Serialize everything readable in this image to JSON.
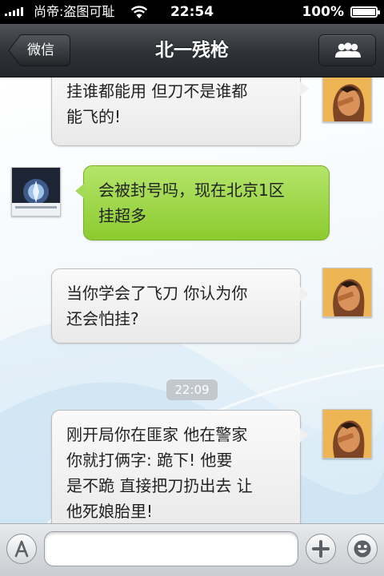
{
  "status_bar": {
    "carrier": "尚帝:盗图可耻",
    "time": "22:54",
    "battery_percent": "100%",
    "battery_level": 1.0,
    "signal_bars": 5,
    "wifi_icon": "wifi-icon"
  },
  "nav": {
    "back_label": "微信",
    "title": "北一残枪",
    "contacts_icon": "contacts-icon"
  },
  "messages": [
    {
      "side": "right",
      "text": "挂谁都能用 但刀不是谁都\n能飞的!"
    },
    {
      "side": "left",
      "text": "会被封号吗，现在北京1区\n挂超多"
    },
    {
      "side": "right",
      "text": "当你学会了飞刀 你认为你\n还会怕挂?"
    },
    {
      "side": "right",
      "text": "刚开局你在匪家 他在警家\n你就打俩字: 跪下! 他要\n是不跪 直接把刀扔出去 让\n他死娘胎里!"
    }
  ],
  "timestamp": "22:09",
  "input_bar": {
    "text_value": "",
    "left_icon": "keyboard-a-icon",
    "plus_icon": "plus-icon",
    "emoji_icon": "smiley-icon"
  },
  "colors": {
    "green_bubble": "#a4db56",
    "gray_bubble": "#f0f0f0",
    "nav_bg": "#2e3236"
  }
}
